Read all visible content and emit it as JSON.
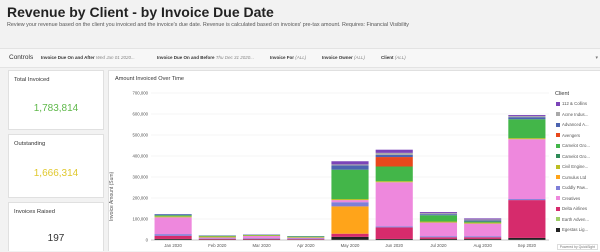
{
  "header": {
    "title": "Revenue by Client - by Invoice Due Date",
    "subtitle": "Review your revenue based on the client you invoiced and the invoice's due date. Revenue is calculated based on invoices' pre-tax amount. Requires: Financial Visibility"
  },
  "controls": {
    "label": "Controls",
    "filters": [
      {
        "name": "Invoice Due On and After",
        "value": "Wed Jan 01 2020..."
      },
      {
        "name": "Invoice Due On and Before",
        "value": "Thu Dec 31 2020..."
      },
      {
        "name": "Invoice For",
        "value": "(ALL)"
      },
      {
        "name": "Invoice Owner",
        "value": "(ALL)"
      },
      {
        "name": "Client",
        "value": "(ALL)"
      }
    ]
  },
  "kpis": {
    "total_invoiced": {
      "label": "Total Invoiced",
      "value": "1,783,814",
      "color": "#5fb84a"
    },
    "outstanding": {
      "label": "Outstanding",
      "value": "1,666,314",
      "color": "#e0c82d"
    },
    "invoices_raised": {
      "label": "Invoices Raised",
      "value": "197",
      "color": "#333333"
    }
  },
  "chart_data": {
    "type": "bar",
    "stacked": true,
    "title": "Amount Invoiced Over Time",
    "ylabel": "Invoice Amount (Sum)",
    "ylim": [
      0,
      700000
    ],
    "yticks": [
      0,
      100000,
      200000,
      300000,
      400000,
      500000,
      600000,
      700000
    ],
    "ytick_labels": [
      "0",
      "100,000",
      "200,000",
      "300,000",
      "400,000",
      "500,000",
      "600,000",
      "700,000"
    ],
    "categories": [
      "Jan 2020",
      "Feb 2020",
      "Mar 2020",
      "Apr 2020",
      "May 2020",
      "Jun 2020",
      "Jul 2020",
      "Aug 2020",
      "Sep 2020"
    ],
    "legend_title": "Client",
    "legend_position": "right",
    "series": [
      {
        "name": "Egestas Lig...",
        "color": "#222222",
        "values": [
          5000,
          2000,
          2000,
          1500,
          15000,
          5000,
          5000,
          5000,
          10000
        ]
      },
      {
        "name": "Delta Airlines",
        "color": "#d62b6c",
        "values": [
          15000,
          3000,
          4000,
          3000,
          15000,
          55000,
          8000,
          8000,
          180000
        ]
      },
      {
        "name": "Cumulus Ltd",
        "color": "#ffa41a",
        "values": [
          0,
          0,
          0,
          0,
          130000,
          0,
          0,
          0,
          0
        ]
      },
      {
        "name": "Cuddly Paw...",
        "color": "#7f7fd8",
        "values": [
          8000,
          2000,
          3000,
          2500,
          20000,
          5000,
          5000,
          5000,
          5000
        ]
      },
      {
        "name": "Creatives",
        "color": "#ee88dd",
        "values": [
          80000,
          5000,
          10000,
          4000,
          10000,
          210000,
          65000,
          60000,
          285000
        ]
      },
      {
        "name": "Civil Engine...",
        "color": "#bcbd22",
        "values": [
          5000,
          5000,
          3000,
          3000,
          5000,
          5000,
          5000,
          5000,
          5000
        ]
      },
      {
        "name": "Camelot Gro...",
        "color": "#43b649",
        "values": [
          5000,
          3000,
          2000,
          3000,
          140000,
          70000,
          30000,
          5000,
          90000
        ]
      },
      {
        "name": "Avengers",
        "color": "#e8481c",
        "values": [
          0,
          0,
          0,
          0,
          0,
          45000,
          0,
          0,
          0
        ]
      },
      {
        "name": "Advanced A...",
        "color": "#4c64b0",
        "values": [
          5000,
          2000,
          2000,
          1500,
          20000,
          10000,
          5000,
          5000,
          10000
        ]
      },
      {
        "name": "Acme Indus...",
        "color": "#a9a9a9",
        "values": [
          0,
          0,
          0,
          0,
          5000,
          10000,
          5000,
          5000,
          5000
        ]
      },
      {
        "name": "112 & Collins",
        "color": "#7b44b8",
        "values": [
          0,
          0,
          0,
          0,
          15000,
          15000,
          5000,
          5000,
          5000
        ]
      }
    ],
    "legend_items": [
      {
        "label": "112 & Collins",
        "color": "#7b44b8"
      },
      {
        "label": "Acme Indus...",
        "color": "#a9a9a9"
      },
      {
        "label": "Advanced A...",
        "color": "#4c64b0"
      },
      {
        "label": "Avengers",
        "color": "#e8481c"
      },
      {
        "label": "Camelot Gro...",
        "color": "#43b649"
      },
      {
        "label": "Camelot Gro...",
        "color": "#2e8b57"
      },
      {
        "label": "Civil Engine...",
        "color": "#bcbd22"
      },
      {
        "label": "Cumulus Ltd",
        "color": "#ffa41a"
      },
      {
        "label": "Cuddly Paw...",
        "color": "#7f7fd8"
      },
      {
        "label": "Creatives",
        "color": "#ee88dd"
      },
      {
        "label": "Delta Airlines",
        "color": "#d62b6c"
      },
      {
        "label": "Earth Adven...",
        "color": "#9ccc65"
      },
      {
        "label": "Egestas Lig...",
        "color": "#222222"
      }
    ]
  },
  "footer": {
    "badge": "Powered by QuickSight"
  }
}
